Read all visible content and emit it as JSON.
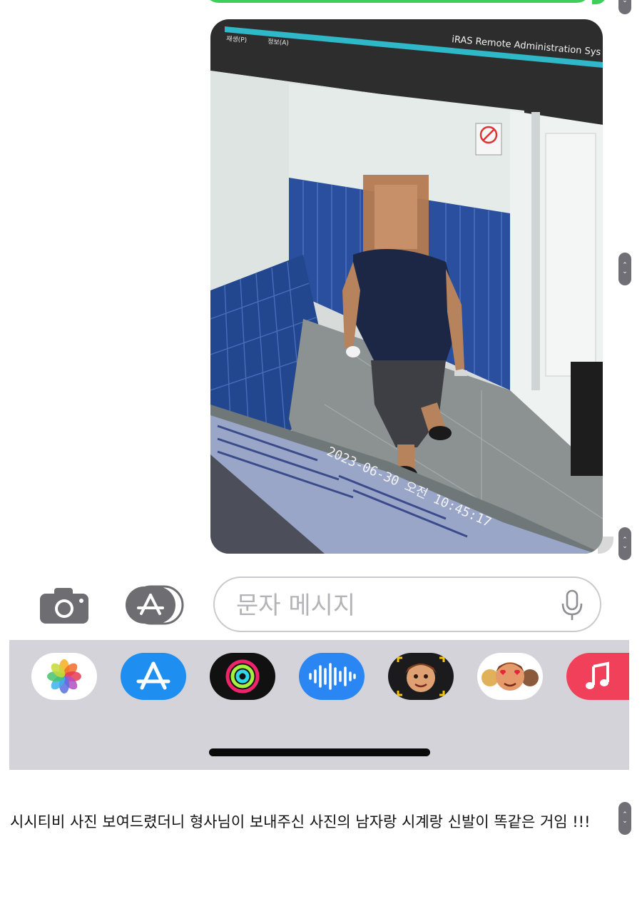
{
  "screenshot": {
    "cctv_window_title": "iRAS Remote Administration Sys",
    "cctv_menu": [
      "재생(P)",
      "정보(A)"
    ],
    "cctv_timestamp": "2023-06-30 오전 10:45:17"
  },
  "compose": {
    "placeholder": "문자 메시지"
  },
  "app_drawer": {
    "apps": [
      "photos-app",
      "app-store-app",
      "activity-app",
      "audio-message-app",
      "memoji-app",
      "memoji-stickers-app",
      "music-app"
    ]
  },
  "caption": {
    "text": "시시티비 사진 보여드렸더니 형사님이 보내주신 사진의 남자랑 시계랑 신발이 똑같은 거임 !!!"
  },
  "colors": {
    "imessage_green": "#3ecf5a",
    "drawer_bg": "#d3d3d9",
    "tile_blue": "#2a4f9e"
  }
}
